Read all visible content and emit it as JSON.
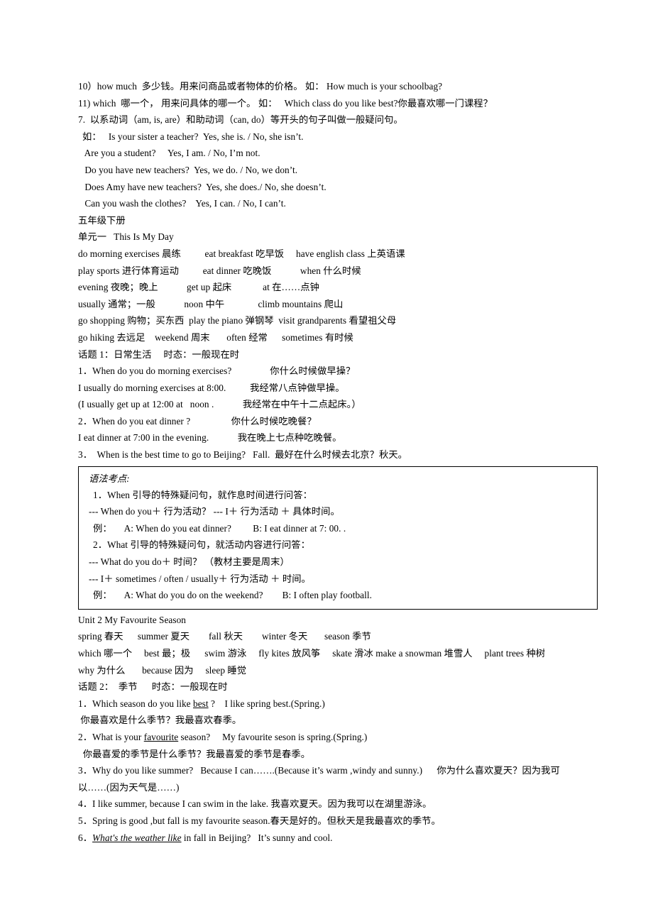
{
  "document": {
    "title": "小学英语复习资料 — 五年级下册",
    "page_background": "#ffffff",
    "text_color": "#000000",
    "box_border_color": "#000000"
  },
  "section_question_words": {
    "lines": [
      "10）how much  多少钱。用来问商品或者物体的价格。 如： How much is your schoolbag?",
      "11) which  哪一个， 用来问具体的哪一个。 如：   Which class do you like best?你最喜欢哪一门课程？",
      "7.  以系动词（am, is, are）和助动词（can, do）等开头的句子叫做一般疑问句。"
    ]
  },
  "section_yesno_examples": {
    "lines": [
      "如：   Is your sister a teacher?  Yes, she is. / No, she isn’t.",
      " Are you a student?     Yes, I am. / No, I’m not.",
      " Do you have new teachers?  Yes, we do. / No, we don’t.",
      " Does Amy have new teachers?  Yes, she does./ No, she doesn’t.",
      " Can you wash the clothes?    Yes, I can. / No, I can’t."
    ]
  },
  "grade_heading": "五年级下册",
  "unit1": {
    "heading": "单元一   This Is My Day",
    "vocabulary_lines": [
      "do morning exercises 晨练          eat breakfast 吃早饭     have english class 上英语课",
      "play sports 进行体育运动          eat dinner 吃晚饭            when 什么时候",
      "evening 夜晚；晚上            get up 起床             at 在……点钟",
      "usually 通常；一般            noon 中午              climb mountains 爬山",
      "go shopping 购物；买东西  play the piano 弹钢琴  visit grandparents 看望祖父母",
      "go hiking 去远足    weekend 周末       often 经常      sometimes 有时候"
    ],
    "topic_line": "话题 1：日常生活     时态：一般现在时",
    "qa_lines": [
      "1．When do you do morning exercises?                你什么时候做早操？",
      "I usually do morning exercises at 8:00.          我经常八点钟做早操。",
      "(I usually get up at 12:00 at   noon .            我经常在中午十二点起床。）",
      "2．When do you eat dinner ?                 你什么时候吃晚餐？",
      "I eat dinner at 7:00 in the evening.            我在晚上七点种吃晚餐。",
      "3．  When is the best time to go to Beijing?   Fall.  最好在什么时候去北京？秋天。"
    ]
  },
  "grammar_box": {
    "title": "语法考点:",
    "lines": [
      "1．When 引导的特殊疑问句，就作息时间进行问答：",
      "--- When do you＋ 行为活动？ --- I＋ 行为活动 ＋ 具体时间。",
      "例：     A: When do you eat dinner?         B: I eat dinner at 7: 00. .",
      "2．What 引导的特殊疑问句，就活动内容进行问答：",
      "--- What do you do＋ 时间？ （教材主要是周末）",
      "--- I＋ sometimes / often / usually＋ 行为活动 ＋ 时间。",
      "例：     A: What do you do on the weekend?        B: I often play football."
    ]
  },
  "unit2": {
    "heading": "Unit 2 My Favourite Season",
    "vocabulary_lines": [
      "spring 春天      summer 夏天        fall 秋天        winter 冬天       season 季节",
      "which 哪一个     best 最；极      swim 游泳     fly kites 放风筝     skate 滑冰 make a snowman 堆雪人     plant trees 种树",
      "why 为什么       because 因为     sleep 睡觉"
    ],
    "topic_line": "话题 2：  季节      时态：一般现在时",
    "qa": [
      {
        "pre": "1．Which season do you like ",
        "emph": "best",
        "emph_style": "underline",
        "post": " ?    I like spring best.(Spring.)"
      },
      {
        "plain": " 你最喜欢是什么季节？我最喜欢春季。"
      },
      {
        "pre": "2．What is your ",
        "emph": "favourite",
        "emph_style": "underline",
        "post": " season?     My favourite seson is spring.(Spring.)"
      },
      {
        "plain": "  你最喜爱的季节是什么季节？我最喜爱的季节是春季。"
      },
      {
        "plain": "3．Why do you like summer?   Because I can…….(Because it’s warm ,windy and sunny.)      你为什么喜欢夏天？因为我可"
      },
      {
        "plain": "以……(因为天气是……)"
      },
      {
        "plain": "4．I like summer, because I can swim in the lake. 我喜欢夏天。因为我可以在湖里游泳。"
      },
      {
        "plain": "5．Spring is good ,but fall is my favourite season.春天是好的。但秋天是我最喜欢的季节。"
      },
      {
        "pre": "6．",
        "emph": "What's the weather like",
        "emph_style": "italic-underline",
        "post": " in fall in Beijing?   It’s sunny and cool."
      }
    ]
  }
}
